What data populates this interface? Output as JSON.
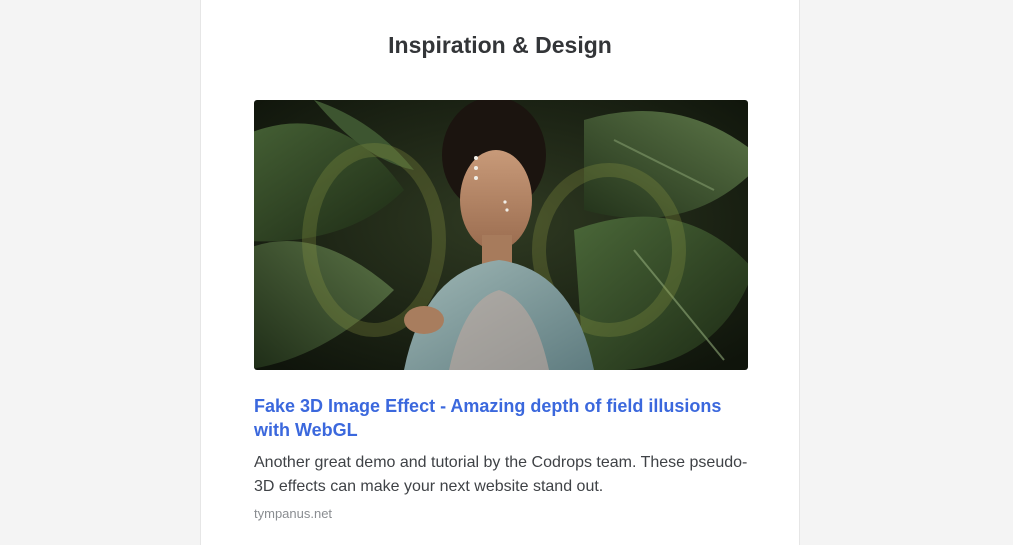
{
  "section": {
    "title": "Inspiration & Design"
  },
  "article": {
    "image_subject": "woman-among-tropical-leaves-photo",
    "title": "Fake 3D Image Effect - Amazing depth of field illusions with WebGL",
    "description": "Another great demo and tutorial by the Codrops team. These pseudo-3D effects can make your next website stand out.",
    "source": "tympanus.net"
  },
  "colors": {
    "page_background": "#f4f4f4",
    "card_background": "#ffffff",
    "heading": "#333538",
    "link": "#3b68dd",
    "body_text": "#3f4246",
    "muted_text": "#8a8d91"
  }
}
